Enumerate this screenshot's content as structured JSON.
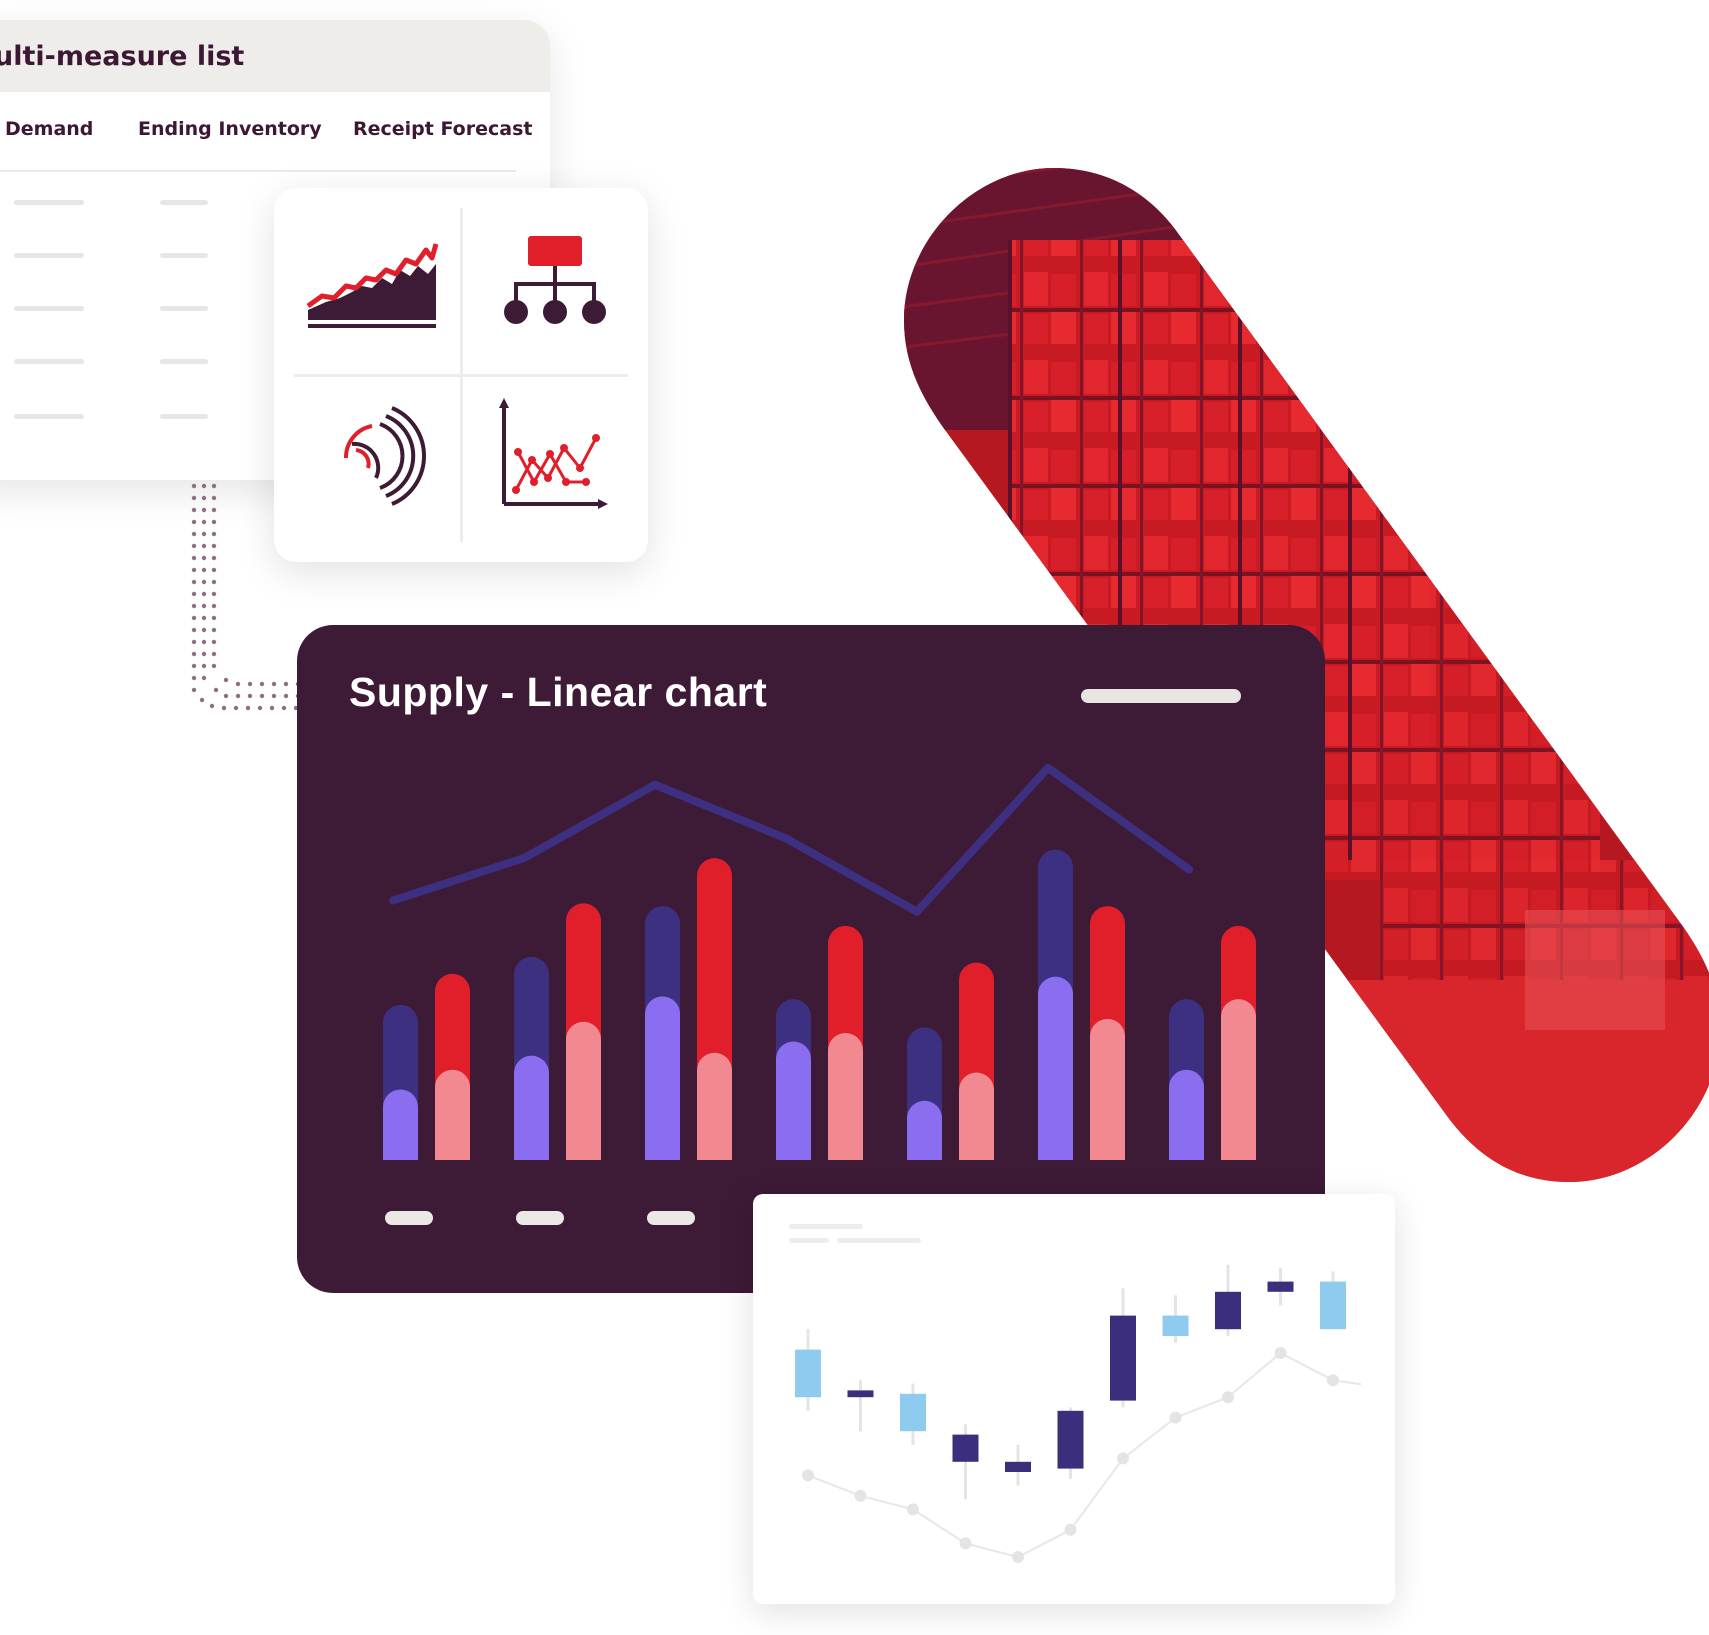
{
  "list_card": {
    "title": "ulti-measure list",
    "columns": [
      "Demand",
      "Ending Inventory",
      "Receipt Forecast"
    ]
  },
  "icon_grid": {
    "icons": [
      "area-trend-chart-icon",
      "hierarchy-tree-icon",
      "radial-spiral-chart-icon",
      "line-scatter-chart-icon"
    ]
  },
  "supply_card": {
    "title": "Supply - Linear chart"
  },
  "chart_data": [
    {
      "type": "bar",
      "title": "Supply - Linear chart",
      "categories": [
        "",
        "",
        "",
        "",
        "",
        "",
        ""
      ],
      "series": [
        {
          "values": [
            55,
            72,
            90,
            57,
            47,
            110,
            57
          ],
          "color": "#3e3080"
        },
        {
          "values": [
            25,
            37,
            58,
            42,
            21,
            65,
            32
          ],
          "color": "#8b6ef0"
        },
        {
          "values": [
            66,
            91,
            107,
            83,
            70,
            90,
            83
          ],
          "color": "#e01f2b"
        },
        {
          "values": [
            32,
            49,
            38,
            45,
            31,
            50,
            57
          ],
          "color": "#f28890"
        }
      ],
      "line": [
        92,
        107,
        133,
        114,
        88,
        139,
        103
      ],
      "line_color": "#3e3080",
      "ylim": [
        0,
        140
      ],
      "grid": false,
      "legend": "none"
    },
    {
      "type": "candlestick",
      "candles": [
        {
          "open": 52,
          "close": 66,
          "high": 72,
          "low": 48,
          "color": "#8ecbee"
        },
        {
          "open": 54,
          "close": 52,
          "high": 57,
          "low": 42,
          "color": "#3b2f7d"
        },
        {
          "open": 53,
          "close": 42,
          "high": 56,
          "low": 38,
          "color": "#8ecbee"
        },
        {
          "open": 41,
          "close": 33,
          "high": 44,
          "low": 22,
          "color": "#3b2f7d"
        },
        {
          "open": 33,
          "close": 30,
          "high": 38,
          "low": 26,
          "color": "#3b2f7d"
        },
        {
          "open": 48,
          "close": 31,
          "high": 49,
          "low": 28,
          "color": "#3b2f7d"
        },
        {
          "open": 76,
          "close": 51,
          "high": 84,
          "low": 49,
          "color": "#3b2f7d"
        },
        {
          "open": 70,
          "close": 76,
          "high": 82,
          "low": 68,
          "color": "#8ecbee"
        },
        {
          "open": 83,
          "close": 72,
          "high": 91,
          "low": 70,
          "color": "#3b2f7d"
        },
        {
          "open": 86,
          "close": 83,
          "high": 90,
          "low": 79,
          "color": "#3b2f7d"
        },
        {
          "open": 86,
          "close": 72,
          "high": 89,
          "low": 72,
          "color": "#8ecbee"
        }
      ],
      "line": [
        29,
        23,
        19,
        9,
        5,
        13,
        34,
        46,
        52,
        65,
        57
      ],
      "line_color": "#e9e7e5",
      "ylim": [
        0,
        100
      ]
    }
  ],
  "colors": {
    "brand_dark": "#3d1a36",
    "brand_red": "#e01f2b",
    "muted_line": "#e8e6e3"
  }
}
